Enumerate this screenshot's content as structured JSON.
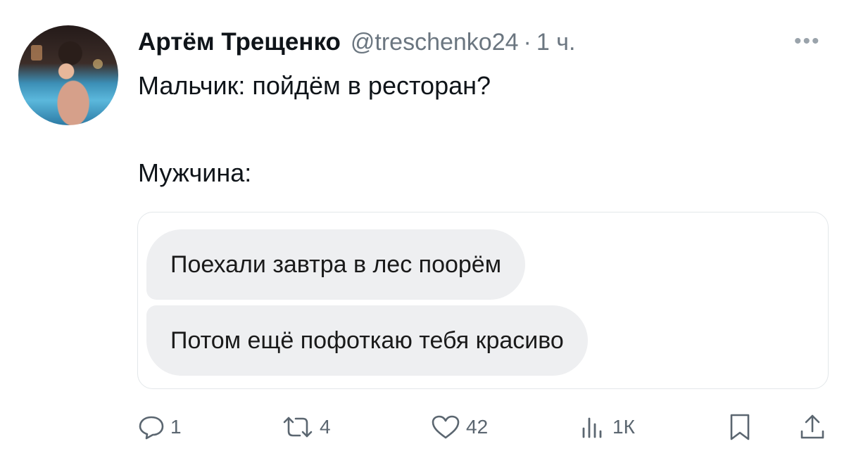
{
  "author": {
    "name": "Артём Трещенко",
    "handle": "@treschenko24",
    "separator": "·",
    "time": "1 ч."
  },
  "more_label": "•••",
  "tweet": {
    "line1": "Мальчик: пойдём в ресторан?",
    "line2": "Мужчина:"
  },
  "media": {
    "messages": [
      "Поехали завтра в лес поорём",
      "Потом ещё пофоткаю тебя красиво"
    ]
  },
  "actions": {
    "replies": "1",
    "reposts": "4",
    "likes": "42",
    "views": "1К"
  },
  "colors": {
    "text": "#0f1419",
    "muted": "#6b7680",
    "bubble": "#eeeff1",
    "border": "#e3e7ea"
  }
}
